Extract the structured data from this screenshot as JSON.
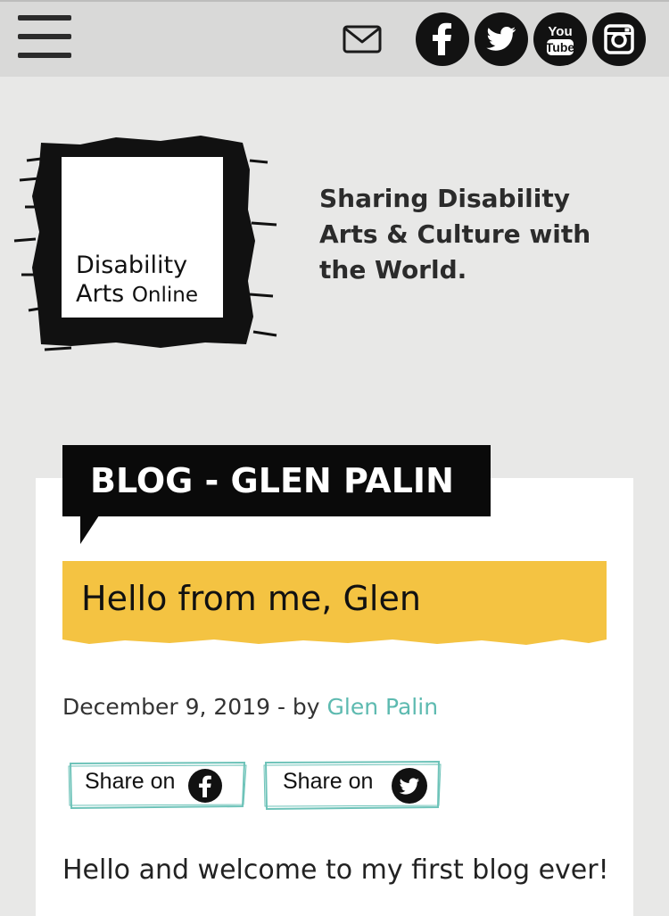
{
  "header": {
    "menu_label": "Menu",
    "icons": [
      "hamburger-menu-icon",
      "mail-icon",
      "facebook-icon",
      "twitter-icon",
      "youtube-icon",
      "instagram-icon"
    ],
    "youtube_text_top": "You",
    "youtube_text_bottom": "Tube"
  },
  "branding": {
    "logo_line1": "Disability",
    "logo_line2_bold": "Arts",
    "logo_line2_light": "Online",
    "tagline": "Sharing Disability\nArts & Culture with\nthe World."
  },
  "post": {
    "section_tag": "BLOG - GLEN PALIN",
    "title": "Hello from me, Glen",
    "date": "December 9, 2019",
    "by_separator": " - by ",
    "author": "Glen Palin",
    "share_facebook": "Share on",
    "share_twitter": "Share on",
    "intro": "Hello and welcome to my first blog ever!"
  },
  "colors": {
    "accent_yellow": "#f4c342",
    "link_teal": "#5dbab0",
    "ink": "#0a0a0a"
  }
}
